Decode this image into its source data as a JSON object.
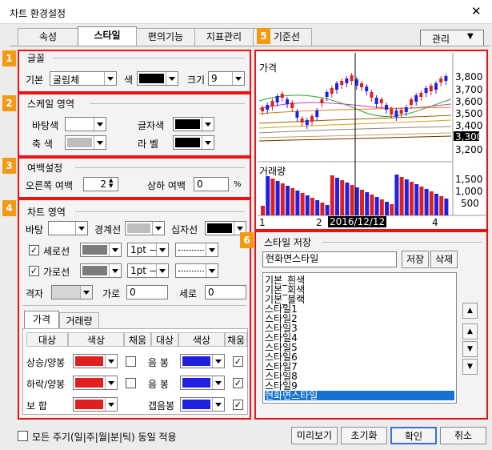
{
  "window": {
    "title": "차트 환경설정",
    "close": "✕"
  },
  "tabs": [
    "속성",
    "스타일",
    "편의기능",
    "지표관리",
    "기준선"
  ],
  "manage_menu": "관리",
  "badges": [
    "1",
    "2",
    "3",
    "4",
    "5",
    "6"
  ],
  "font": {
    "group": "글꼴",
    "basic_label": "기본",
    "basic_value": "굴림체",
    "color_label": "색",
    "size_label": "크기",
    "size_value": "9"
  },
  "scale": {
    "group": "스케일 영역",
    "bg_label": "바탕색",
    "text_label": "글자색",
    "axis_label": "축  색",
    "label_label": "라  벨"
  },
  "margin": {
    "group": "여백설정",
    "right_label": "오른쪽 여백",
    "right_value": "2",
    "updown_label": "상하 여백",
    "updown_value": "0",
    "unit": "%"
  },
  "chart_area": {
    "group": "차트 영역",
    "bg_label": "바탕",
    "border_label": "경계선",
    "cross_label": "십자선",
    "vline_label": "세로선",
    "hline_label": "가로선",
    "line_width": "1pt —",
    "grid_label": "격자",
    "horiz_label": "가로",
    "horiz_value": "0",
    "vert_label": "세로",
    "vert_value": "0"
  },
  "sub_tabs": [
    "가격",
    "거래량"
  ],
  "price_table": {
    "headers": [
      "대상",
      "색상",
      "채움",
      "대상",
      "색상",
      "채움"
    ],
    "rows": [
      {
        "left": "상승/양봉",
        "right": "음  봉"
      },
      {
        "left": "하락/양봉",
        "right": "음  봉"
      },
      {
        "left": "보   합",
        "right": "갭음봉"
      }
    ]
  },
  "preview": {
    "price_label": "가격",
    "volume_label": "거래량",
    "price_ticks": [
      "3,800",
      "3,700",
      "3,600",
      "3,500",
      "3,400",
      "3,300",
      "3,200"
    ],
    "current": "3,300",
    "volume_ticks": [
      "1,500",
      "1,000",
      "500"
    ],
    "x_ticks": [
      "1",
      "2",
      "4"
    ],
    "cursor_date": "2016/12/12"
  },
  "style_save": {
    "group": "스타일 저장",
    "name_value": "현화면스타일",
    "save": "저장",
    "delete": "삭제",
    "items": [
      "기본_흰색",
      "기본_회색",
      "기본_블랙",
      "스타일1",
      "스타일2",
      "스타일3",
      "스타일4",
      "스타일5",
      "스타일6",
      "스타일7",
      "스타일8",
      "스타일9",
      "현화면스타일"
    ],
    "selected": "현화면스타일"
  },
  "apply_all": "모든 주기(일|주|월|분|틱) 동일 적용",
  "footer": {
    "preview": "미리보기",
    "reset": "초기화",
    "ok": "확인",
    "cancel": "취소"
  },
  "colors": {
    "red": "#e02020",
    "blue": "#2020e0",
    "black": "#000000",
    "gray": "#bdbdbd",
    "dark_gray": "#7b7b7b",
    "accent": "#e11111",
    "selection": "#1672d0"
  }
}
